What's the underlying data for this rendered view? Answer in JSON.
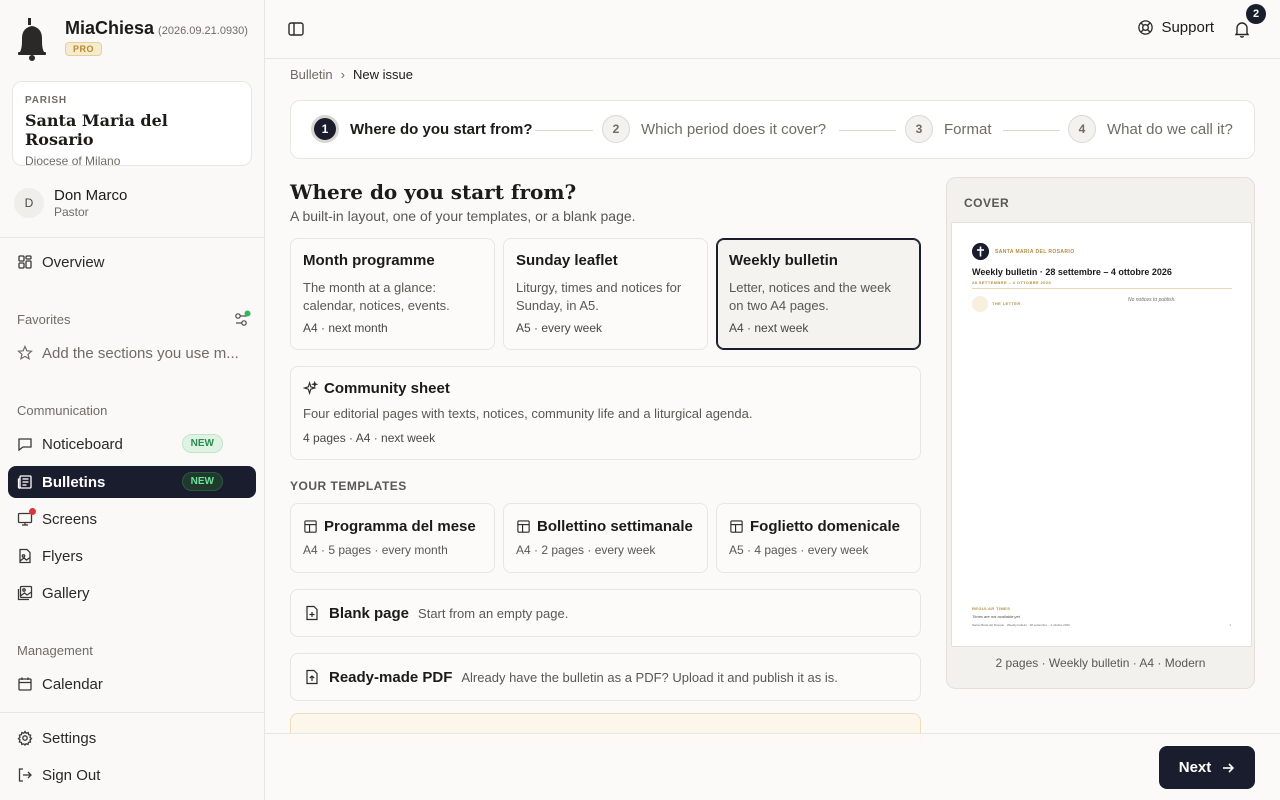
{
  "app": {
    "name": "MiaChiesa",
    "version": "(2026.09.21.0930)",
    "plan_badge": "PRO"
  },
  "parish": {
    "label": "PARISH",
    "name": "Santa Maria del Rosario",
    "diocese": "Diocese of Milano"
  },
  "user": {
    "initial": "D",
    "name": "Don Marco",
    "role": "Pastor"
  },
  "sidebar": {
    "overview": "Overview",
    "favorites_label": "Favorites",
    "favorites_placeholder": "Add the sections you use m...",
    "communication_label": "Communication",
    "communication_items": [
      {
        "label": "Noticeboard",
        "badge": "NEW"
      },
      {
        "label": "Bulletins",
        "badge": "NEW"
      },
      {
        "label": "Screens"
      },
      {
        "label": "Flyers"
      },
      {
        "label": "Gallery"
      }
    ],
    "management_label": "Management",
    "calendar": "Calendar",
    "settings": "Settings",
    "sign_out": "Sign Out"
  },
  "header": {
    "support": "Support",
    "notifications_count": "2"
  },
  "breadcrumb": {
    "parent": "Bulletin",
    "separator": "›",
    "current": "New issue"
  },
  "steps": [
    {
      "num": "1",
      "label": "Where do you start from?",
      "active": true
    },
    {
      "num": "2",
      "label": "Which period does it cover?"
    },
    {
      "num": "3",
      "label": "Format"
    },
    {
      "num": "4",
      "label": "What do we call it?"
    }
  ],
  "main": {
    "title": "Where do you start from?",
    "subtitle": "A built-in layout, one of your templates, or a blank page.",
    "layouts": [
      {
        "title": "Month programme",
        "desc": "The month at a glance: calendar, notices, events.",
        "meta": "A4 · next month"
      },
      {
        "title": "Sunday leaflet",
        "desc": "Liturgy, times and notices for Sunday, in A5.",
        "meta": "A5 · every week"
      },
      {
        "title": "Weekly bulletin",
        "desc": "Letter, notices and the week on two A4 pages.",
        "meta": "A4 · next week",
        "selected": true
      }
    ],
    "community": {
      "title": "Community sheet",
      "desc": "Four editorial pages with texts, notices, community life and a liturgical agenda.",
      "meta": "4 pages · A4 · next week"
    },
    "templates_label": "YOUR TEMPLATES",
    "templates": [
      {
        "title": "Programma del mese",
        "meta": "A4 · 5 pages · every month"
      },
      {
        "title": "Bollettino settimanale",
        "meta": "A4 · 2 pages · every week"
      },
      {
        "title": "Foglietto domenicale",
        "meta": "A5 · 4 pages · every week"
      }
    ],
    "blank": {
      "title": "Blank page",
      "desc": "Start from an empty page."
    },
    "pdf": {
      "title": "Ready-made PDF",
      "desc": "Already have the bulletin as a PDF? Upload it and publish it as is."
    }
  },
  "cover": {
    "label": "COVER",
    "parish_header": "SANTA MARIA DEL ROSARIO",
    "title": "Weekly bulletin · 28 settembre – 4 ottobre 2026",
    "dates": "28 SETTEMBRE – 4 OTTOBRE 2026",
    "letter_label": "THE LETTER",
    "notices_empty": "No notices to publish.",
    "regular_label": "REGULAR TIMES",
    "times_empty": "Times are not available yet.",
    "footer": "Santa Maria del Rosario · Weekly bulletin · 28 settembre – 4 ottobre 2026",
    "page_num": "1",
    "caption": "2 pages · Weekly bulletin · A4 · Modern"
  },
  "footer": {
    "next": "Next"
  },
  "colors": {
    "primary_dark": "#1a1d2e",
    "accent_gold": "#b58c3e",
    "new_badge_green": "#2c8a4a",
    "alert_red": "#e0343d"
  },
  "icons": {
    "logo": "bell-icon",
    "overview": "grid-icon",
    "favorites": "star-icon",
    "noticeboard": "message-square-icon",
    "bulletins": "newspaper-icon",
    "screens": "monitor-icon",
    "flyers": "file-image-icon",
    "gallery": "images-icon",
    "calendar": "calendar-icon",
    "settings": "gear-icon",
    "sign_out": "log-out-icon"
  }
}
